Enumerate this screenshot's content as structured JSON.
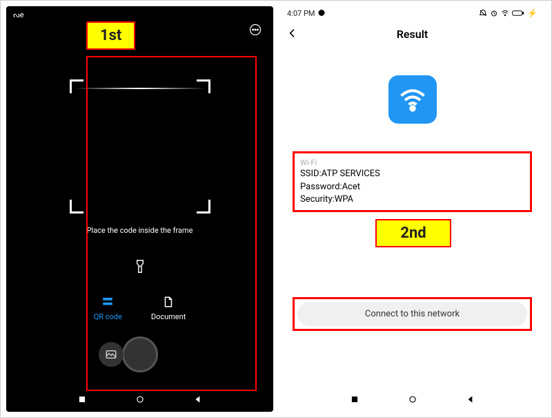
{
  "callouts": {
    "first": "1st",
    "second": "2nd"
  },
  "left": {
    "instruction": "Place the code inside the frame",
    "tabs": {
      "qr": "QR code",
      "document": "Document"
    }
  },
  "right": {
    "status_time": "4:07 PM",
    "title": "Result",
    "wifi_label": "Wi-Fi",
    "ssid_line": "SSID:ATP SERVICES",
    "password_line": "Password:Acet",
    "security_line": "Security:WPA",
    "connect_label": "Connect to this network"
  }
}
